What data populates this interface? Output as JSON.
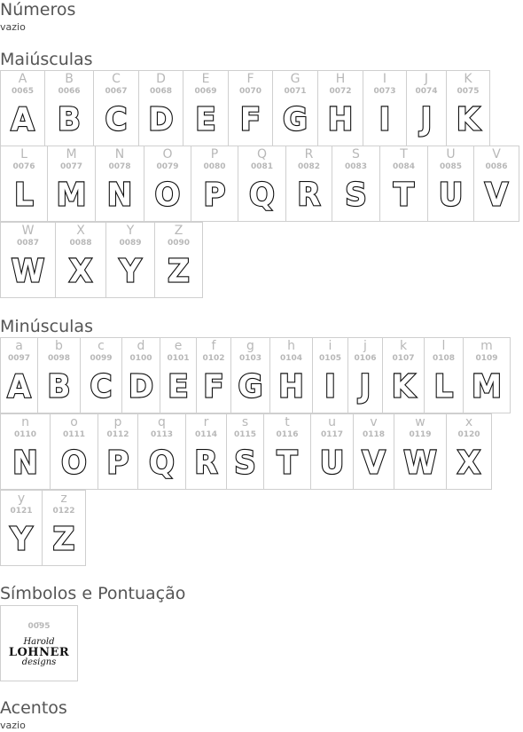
{
  "sections": {
    "numeros": {
      "title": "Números",
      "note": "vazio"
    },
    "maiusculas": {
      "title": "Maiúsculas"
    },
    "minusculas": {
      "title": "Minúsculas"
    },
    "simbolos": {
      "title": "Símbolos e Pontuação"
    },
    "acentos": {
      "title": "Acentos",
      "note": "vazio"
    }
  },
  "upper": [
    {
      "ch": "A",
      "code": "0065"
    },
    {
      "ch": "B",
      "code": "0066"
    },
    {
      "ch": "C",
      "code": "0067"
    },
    {
      "ch": "D",
      "code": "0068"
    },
    {
      "ch": "E",
      "code": "0069"
    },
    {
      "ch": "F",
      "code": "0070"
    },
    {
      "ch": "G",
      "code": "0071"
    },
    {
      "ch": "H",
      "code": "0072"
    },
    {
      "ch": "I",
      "code": "0073"
    },
    {
      "ch": "J",
      "code": "0074"
    },
    {
      "ch": "K",
      "code": "0075"
    },
    {
      "ch": "L",
      "code": "0076"
    },
    {
      "ch": "M",
      "code": "0077"
    },
    {
      "ch": "N",
      "code": "0078"
    },
    {
      "ch": "O",
      "code": "0079"
    },
    {
      "ch": "P",
      "code": "0080"
    },
    {
      "ch": "Q",
      "code": "0081"
    },
    {
      "ch": "R",
      "code": "0082"
    },
    {
      "ch": "S",
      "code": "0083"
    },
    {
      "ch": "T",
      "code": "0084"
    },
    {
      "ch": "U",
      "code": "0085"
    },
    {
      "ch": "V",
      "code": "0086"
    },
    {
      "ch": "W",
      "code": "0087"
    },
    {
      "ch": "X",
      "code": "0088"
    },
    {
      "ch": "Y",
      "code": "0089"
    },
    {
      "ch": "Z",
      "code": "0090"
    }
  ],
  "lower": [
    {
      "ch": "a",
      "code": "0097"
    },
    {
      "ch": "b",
      "code": "0098"
    },
    {
      "ch": "c",
      "code": "0099"
    },
    {
      "ch": "d",
      "code": "0100"
    },
    {
      "ch": "e",
      "code": "0101"
    },
    {
      "ch": "f",
      "code": "0102"
    },
    {
      "ch": "g",
      "code": "0103"
    },
    {
      "ch": "h",
      "code": "0104"
    },
    {
      "ch": "i",
      "code": "0105"
    },
    {
      "ch": "j",
      "code": "0106"
    },
    {
      "ch": "k",
      "code": "0107"
    },
    {
      "ch": "l",
      "code": "0108"
    },
    {
      "ch": "m",
      "code": "0109"
    },
    {
      "ch": "n",
      "code": "0110"
    },
    {
      "ch": "o",
      "code": "0111"
    },
    {
      "ch": "p",
      "code": "0112"
    },
    {
      "ch": "q",
      "code": "0113"
    },
    {
      "ch": "r",
      "code": "0114"
    },
    {
      "ch": "s",
      "code": "0115"
    },
    {
      "ch": "t",
      "code": "0116"
    },
    {
      "ch": "u",
      "code": "0117"
    },
    {
      "ch": "v",
      "code": "0118"
    },
    {
      "ch": "w",
      "code": "0119"
    },
    {
      "ch": "x",
      "code": "0120"
    },
    {
      "ch": "y",
      "code": "0121"
    },
    {
      "ch": "z",
      "code": "0122"
    }
  ],
  "symbols": [
    {
      "ch": "_",
      "code": "0095",
      "logo": [
        "Harold",
        "LOHNER",
        "designs"
      ]
    }
  ]
}
